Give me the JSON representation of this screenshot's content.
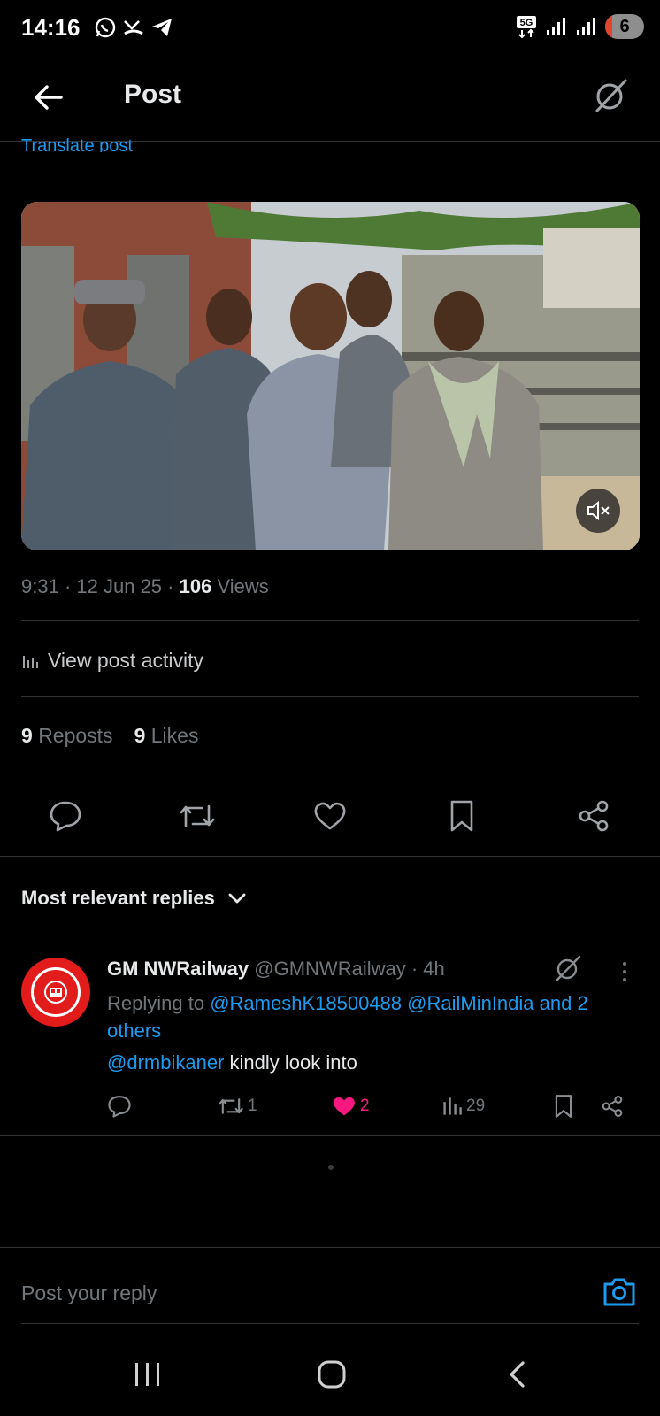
{
  "status_bar": {
    "time": "14:16",
    "network": "5G",
    "battery": "6"
  },
  "header": {
    "title": "Post"
  },
  "post": {
    "translate_label": "Translate post",
    "time": "9:31",
    "date": "12 Jun 25",
    "views_count": "106",
    "views_label": "Views",
    "view_activity_label": "View post activity",
    "reposts_count": "9",
    "reposts_label": "Reposts",
    "likes_count": "9",
    "likes_label": "Likes"
  },
  "replies": {
    "sort_label": "Most relevant replies",
    "items": [
      {
        "name": "GM NWRailway",
        "handle": "@GMNWRailway",
        "age": "4h",
        "replying_prefix": "Replying to",
        "replying_to_1": "@RameshK18500488",
        "replying_to_2": "@RailMinIndia",
        "replying_and": "and 2 others",
        "mention": "@drmbikaner",
        "text": "kindly look into",
        "repost_count": "1",
        "like_count": "2",
        "view_count": "29"
      }
    ]
  },
  "composer": {
    "placeholder": "Post your reply"
  },
  "colors": {
    "background": "#000000",
    "accent": "#1d9bf0",
    "like": "#f91880",
    "muted": "#71767b",
    "divider": "#2f3336"
  }
}
